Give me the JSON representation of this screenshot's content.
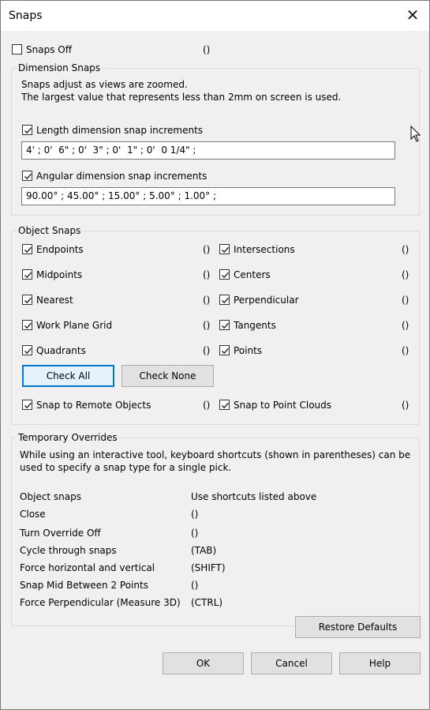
{
  "window": {
    "title": "Snaps"
  },
  "snaps_off": {
    "label": "Snaps Off",
    "shortcut": "()",
    "checked": false
  },
  "dimension_snaps": {
    "legend": "Dimension Snaps",
    "info_line1": "Snaps adjust as views are zoomed.",
    "info_line2": "The largest value that represents less than 2mm on screen is used.",
    "length": {
      "label": "Length dimension snap increments",
      "checked": true,
      "value": "4' ; 0'  6\" ; 0'  3\" ; 0'  1\" ; 0'  0 1/4\" ;"
    },
    "angular": {
      "label": "Angular dimension snap increments",
      "checked": true,
      "value": "90.00° ; 45.00° ; 15.00° ; 5.00° ; 1.00° ;"
    }
  },
  "object_snaps": {
    "legend": "Object Snaps",
    "left": [
      {
        "label": "Endpoints",
        "shortcut": "()",
        "checked": true
      },
      {
        "label": "Midpoints",
        "shortcut": "()",
        "checked": true
      },
      {
        "label": "Nearest",
        "shortcut": "()",
        "checked": true
      },
      {
        "label": "Work Plane Grid",
        "shortcut": "()",
        "checked": true
      },
      {
        "label": "Quadrants",
        "shortcut": "()",
        "checked": true
      }
    ],
    "right": [
      {
        "label": "Intersections",
        "shortcut": "()",
        "checked": true
      },
      {
        "label": "Centers",
        "shortcut": "()",
        "checked": true
      },
      {
        "label": "Perpendicular",
        "shortcut": "()",
        "checked": true
      },
      {
        "label": "Tangents",
        "shortcut": "()",
        "checked": true
      },
      {
        "label": "Points",
        "shortcut": "()",
        "checked": true
      }
    ],
    "check_all": "Check All",
    "check_none": "Check None",
    "remote": {
      "label": "Snap to Remote Objects",
      "shortcut": "()",
      "checked": true
    },
    "point_clouds": {
      "label": "Snap to Point Clouds",
      "shortcut": "()",
      "checked": true
    }
  },
  "temporary_overrides": {
    "legend": "Temporary Overrides",
    "info_line1": "While using an interactive tool, keyboard shortcuts (shown in parentheses) can be",
    "info_line2": "used to specify a snap type for a single pick.",
    "rows": [
      {
        "name": "Object snaps",
        "value": "Use shortcuts listed above"
      },
      {
        "name": "Close",
        "value": "()"
      },
      {
        "name": "Turn Override Off",
        "value": "()"
      },
      {
        "name": "Cycle through snaps",
        "value": "(TAB)"
      },
      {
        "name": "Force horizontal and vertical",
        "value": "(SHIFT)"
      },
      {
        "name": "Snap Mid Between 2 Points",
        "value": "()"
      },
      {
        "name": "Force Perpendicular (Measure 3D)",
        "value": "(CTRL)"
      }
    ]
  },
  "buttons": {
    "restore": "Restore Defaults",
    "ok": "OK",
    "cancel": "Cancel",
    "help": "Help"
  },
  "colors": {
    "accent": "#0078d7",
    "dialog_bg": "#f0f0f0"
  }
}
